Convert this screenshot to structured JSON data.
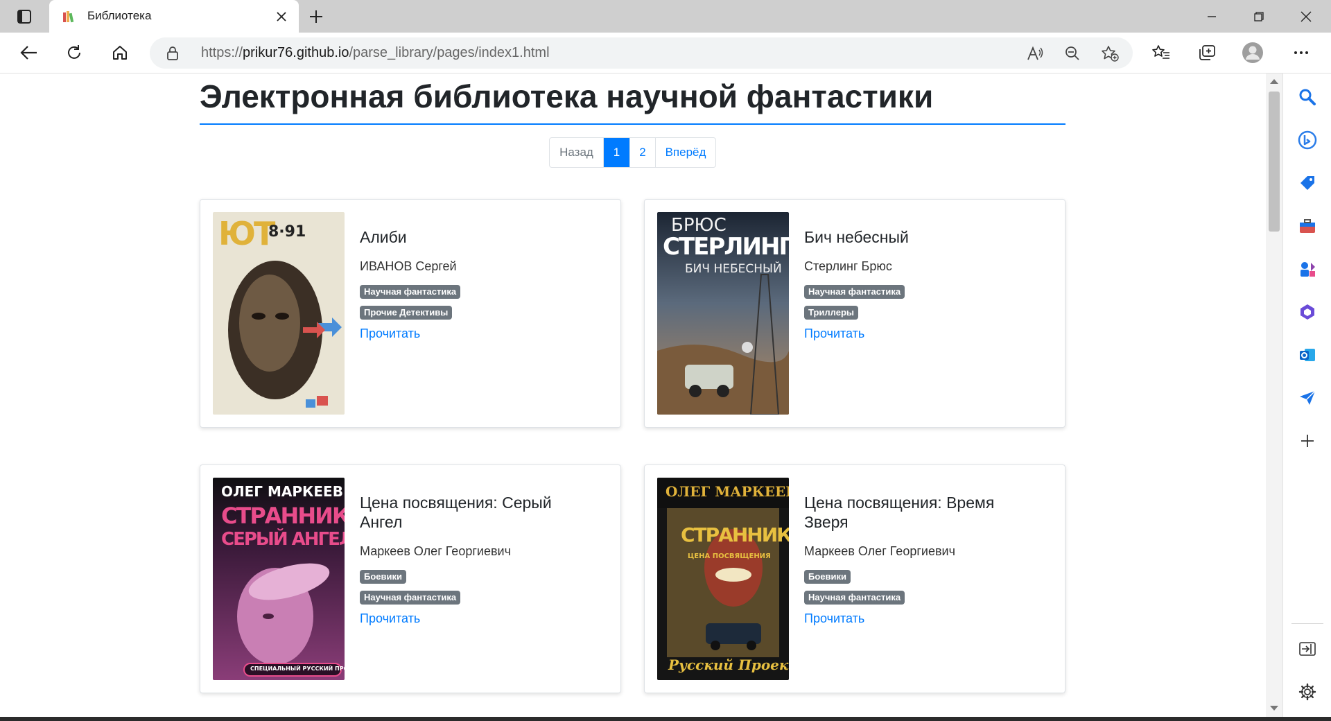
{
  "browser": {
    "tab_title": "Библиотека",
    "url_prefix": "https://",
    "url_host": "prikur76.github.io",
    "url_path": "/parse_library/pages/index1.html"
  },
  "page": {
    "title": "Электронная библиотека научной фантастики",
    "pagination": {
      "prev": "Назад",
      "pages": [
        "1",
        "2"
      ],
      "active": "1",
      "next": "Вперёд"
    },
    "read_label": "Прочитать"
  },
  "books": [
    {
      "title": "Алиби",
      "author": "ИВАНОВ Сергей",
      "genres": [
        "Научная фантастика",
        "Прочие Детективы"
      ],
      "cover": {
        "issue": "8·91",
        "logo": "ЮТ"
      }
    },
    {
      "title": "Бич небесный",
      "author": "Стерлинг Брюс",
      "genres": [
        "Научная фантастика",
        "Триллеры"
      ],
      "cover": {
        "line1": "БРЮС",
        "line2": "СТЕРЛИНГ",
        "line3": "БИЧ НЕБЕСНЫЙ"
      }
    },
    {
      "title": "Цена посвящения: Серый Ангел",
      "author": "Маркеев Олег Георгиевич",
      "genres": [
        "Боевики",
        "Научная фантастика"
      ],
      "cover": {
        "line1": "ОЛЕГ МАРКЕЕВ",
        "line2": "СТРАННИК",
        "line3": "СЕРЫЙ АНГЕЛ",
        "line4": "СПЕЦИАЛЬНЫЙ РУССКИЙ ПРОЕКТ"
      }
    },
    {
      "title": "Цена посвящения: Время Зверя",
      "author": "Маркеев Олег Георгиевич",
      "genres": [
        "Боевики",
        "Научная фантастика"
      ],
      "cover": {
        "line1": "ОЛЕГ МАРКЕЕВ",
        "line2": "СТРАННИК",
        "line3": "ЦЕНА ПОСВЯЩЕНИЯ",
        "line4": "Русский Проект"
      }
    }
  ],
  "colors": {
    "accent": "#007bff",
    "badge": "#6c757d"
  }
}
